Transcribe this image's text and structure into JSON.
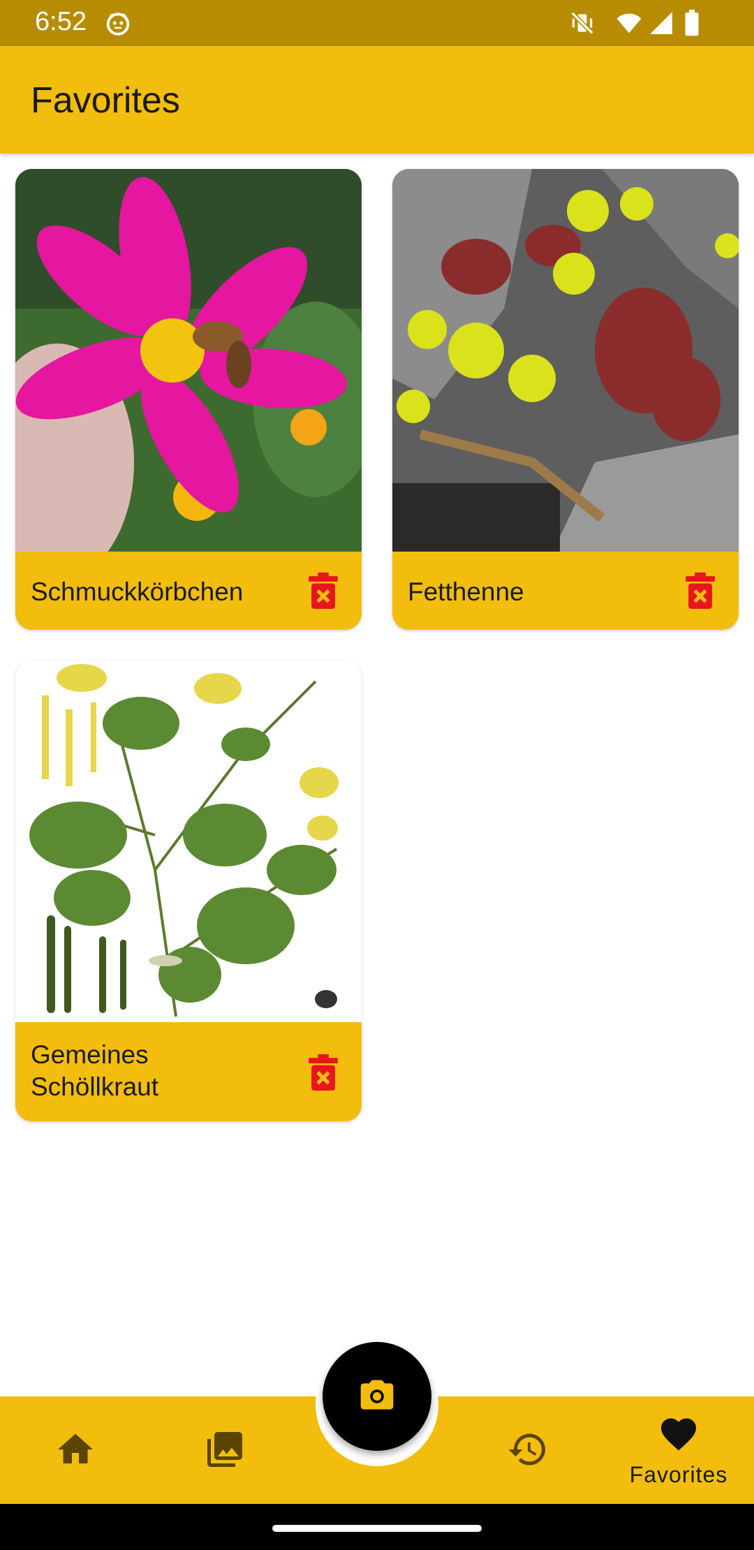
{
  "status_bar": {
    "time": "6:52",
    "icons": [
      "app-notification-icon",
      "mute-vibrate-icon",
      "wifi-icon",
      "signal-icon",
      "battery-icon"
    ]
  },
  "app_bar": {
    "title": "Favorites"
  },
  "favorites": [
    {
      "name": "Schmuckkörbchen",
      "image": "pink-cosmos-flower-with-bee"
    },
    {
      "name": "Fetthenne",
      "image": "yellow-stonecrop-on-rock"
    },
    {
      "name": "Gemeines Schöllkraut",
      "image": "greater-celandine-botanical-illustration"
    }
  ],
  "bottom_nav": {
    "items": [
      "home-icon",
      "gallery-icon",
      "history-icon",
      "heart-icon"
    ],
    "active_label": "Favorites",
    "fab_icon": "camera-icon"
  },
  "colors": {
    "accent": "#f2bd0c",
    "status_bar": "#b78c03",
    "delete": "#e8141e"
  }
}
